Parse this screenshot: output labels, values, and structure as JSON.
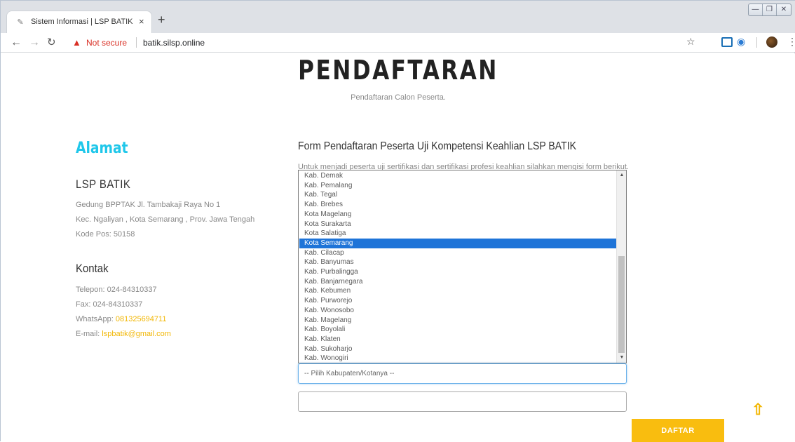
{
  "browser": {
    "tab_title": "Sistem Informasi | LSP BATIK",
    "tab_close": "×",
    "new_tab": "+",
    "not_secure": "Not secure",
    "url": "batik.silsp.online",
    "icons": {
      "favicon": "pen-icon",
      "back": "back-arrow-icon",
      "forward": "forward-arrow-icon",
      "reload": "reload-icon",
      "warning": "warning-triangle-icon",
      "star": "star-icon",
      "menu": "kebab-menu-icon"
    }
  },
  "hero": {
    "title": "PENDAFTARAN",
    "subtitle": "Pendaftaran Calon Peserta."
  },
  "sidebar": {
    "heading": "Alamat",
    "org_name": "LSP BATIK",
    "address_lines": [
      "Gedung BPPTAK Jl. Tambakaji Raya No 1",
      "Kec. Ngaliyan , Kota Semarang , Prov. Jawa Tengah",
      "Kode Pos: 50158"
    ],
    "contact_heading": "Kontak",
    "phone": "Telepon: 024-84310337",
    "fax": "Fax: 024-84310337",
    "whatsapp_label": "WhatsApp: ",
    "whatsapp_value": "081325694711",
    "email_label": "E-mail: ",
    "email_value": "lspbatik@gmail.com"
  },
  "form": {
    "title": "Form Pendaftaran Peserta Uji Kompetensi Keahlian LSP BATIK",
    "description": "Untuk menjadi peserta uji sertifikasi dan sertifikasi profesi keahlian silahkan mengisi form berikut.",
    "dropdown_options": [
      "Kab. Demak",
      "Kab. Pemalang",
      "Kab. Tegal",
      "Kab. Brebes",
      "Kota Magelang",
      "Kota Surakarta",
      "Kota Salatiga",
      "Kota Semarang",
      "Kab. Cilacap",
      "Kab. Banyumas",
      "Kab. Purbalingga",
      "Kab. Banjarnegara",
      "Kab. Kebumen",
      "Kab. Purworejo",
      "Kab. Wonosobo",
      "Kab. Magelang",
      "Kab. Boyolali",
      "Kab. Klaten",
      "Kab. Sukoharjo",
      "Kab. Wonogiri"
    ],
    "highlighted_option": "Kota Semarang",
    "select_placeholder": "-- Pilih Kabupaten/Kotanya --",
    "submit_label": "DAFTAR"
  },
  "colors": {
    "accent_cyan": "#1fc7ea",
    "accent_yellow": "#f9bd0f",
    "selection_blue": "#1e74d8",
    "warning_red": "#d93025"
  }
}
